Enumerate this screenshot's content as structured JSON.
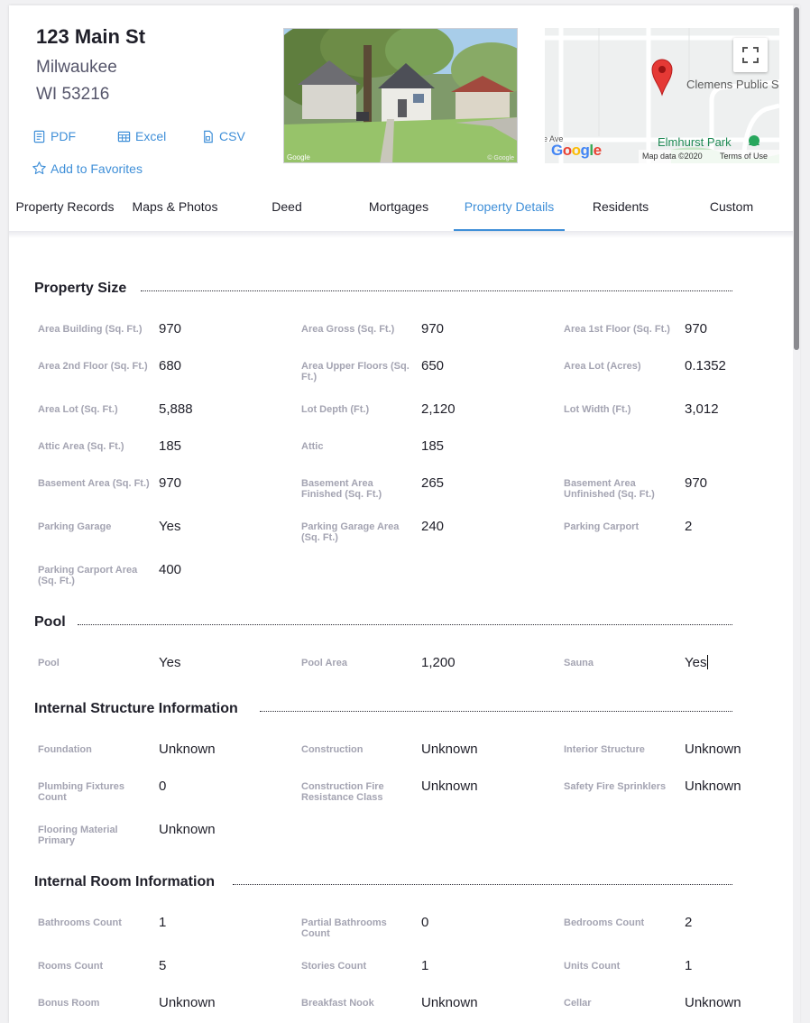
{
  "property": {
    "street": "123 Main St",
    "city": "Milwaukee",
    "state_zip": "WI 53216"
  },
  "exports": [
    {
      "label": "PDF",
      "icon": "pdf-file-icon"
    },
    {
      "label": "Excel",
      "icon": "spreadsheet-icon"
    },
    {
      "label": "CSV",
      "icon": "csv-file-icon"
    }
  ],
  "favorites_label": "Add to Favorites",
  "photo": {
    "brand": "Google",
    "corner_text": "© Google"
  },
  "map": {
    "label_place": "Clemens Public S",
    "label_park": "Elmhurst Park",
    "label_street": "e Ave",
    "google": "Google",
    "attribution": "Map data ©2020",
    "terms": "Terms of Use",
    "colors": {
      "pin": "#e53935",
      "park": "#1f8a55",
      "water": "#9ad0f5"
    }
  },
  "tabs": [
    {
      "label": "Property Records",
      "active": false
    },
    {
      "label": "Maps & Photos",
      "active": false
    },
    {
      "label": "Deed",
      "active": false
    },
    {
      "label": "Mortgages",
      "active": false
    },
    {
      "label": "Property Details",
      "active": true
    },
    {
      "label": "Residents",
      "active": false
    },
    {
      "label": "Custom",
      "active": false
    }
  ],
  "accent_color": "#3f8fd8",
  "sections": [
    {
      "title": "Property Size",
      "rows": [
        [
          {
            "label": "Area Building (Sq. Ft.)",
            "value": "970"
          },
          {
            "label": "Area Gross (Sq. Ft.)",
            "value": "970"
          },
          {
            "label": "Area 1st Floor (Sq. Ft.)",
            "value": "970"
          }
        ],
        [
          {
            "label": "Area 2nd Floor (Sq. Ft.)",
            "value": "680"
          },
          {
            "label": "Area Upper Floors (Sq. Ft.)",
            "value": "650"
          },
          {
            "label": "Area Lot (Acres)",
            "value": "0.1352"
          }
        ],
        [
          {
            "label": "Area Lot (Sq. Ft.)",
            "value": "5,888"
          },
          {
            "label": "Lot Depth (Ft.)",
            "value": "2,120"
          },
          {
            "label": "Lot Width (Ft.)",
            "value": "3,012"
          }
        ],
        [
          {
            "label": "Attic Area (Sq. Ft.)",
            "value": "185"
          },
          {
            "label": "Attic",
            "value": "185"
          }
        ],
        [
          {
            "label": "Basement Area (Sq. Ft.)",
            "value": "970"
          },
          {
            "label": "Basement Area Finished (Sq. Ft.)",
            "value": "265"
          },
          {
            "label": "Basement Area Unfinished (Sq. Ft.)",
            "value": "970"
          }
        ],
        [
          {
            "label": "Parking Garage",
            "value": "Yes"
          },
          {
            "label": "Parking Garage Area (Sq. Ft.)",
            "value": "240"
          },
          {
            "label": "Parking Carport",
            "value": "2"
          }
        ],
        [
          {
            "label": "Parking Carport Area (Sq. Ft.)",
            "value": "400"
          }
        ]
      ]
    },
    {
      "title": "Pool",
      "rows": [
        [
          {
            "label": "Pool",
            "value": "Yes"
          },
          {
            "label": "Pool Area",
            "value": "1,200"
          },
          {
            "label": "Sauna",
            "value": "Yes"
          }
        ]
      ]
    },
    {
      "title": "Internal Structure Information",
      "rows": [
        [
          {
            "label": "Foundation",
            "value": "Unknown"
          },
          {
            "label": "Construction",
            "value": "Unknown"
          },
          {
            "label": "Interior Structure",
            "value": "Unknown"
          }
        ],
        [
          {
            "label": "Plumbing Fixtures Count",
            "value": "0"
          },
          {
            "label": "Construction Fire Resistance Class",
            "value": "Unknown"
          },
          {
            "label": "Safety Fire Sprinklers",
            "value": "Unknown"
          }
        ],
        [
          {
            "label": "Flooring Material Primary",
            "value": "Unknown"
          }
        ]
      ]
    },
    {
      "title": "Internal Room Information",
      "rows": [
        [
          {
            "label": "Bathrooms Count",
            "value": "1"
          },
          {
            "label": "Partial Bathrooms Count",
            "value": "0"
          },
          {
            "label": "Bedrooms Count",
            "value": "2"
          }
        ],
        [
          {
            "label": "Rooms Count",
            "value": "5"
          },
          {
            "label": "Stories Count",
            "value": "1"
          },
          {
            "label": "Units Count",
            "value": "1"
          }
        ],
        [
          {
            "label": "Bonus Room",
            "value": "Unknown"
          },
          {
            "label": "Breakfast Nook",
            "value": "Unknown"
          },
          {
            "label": "Cellar",
            "value": "Unknown"
          }
        ]
      ]
    }
  ]
}
